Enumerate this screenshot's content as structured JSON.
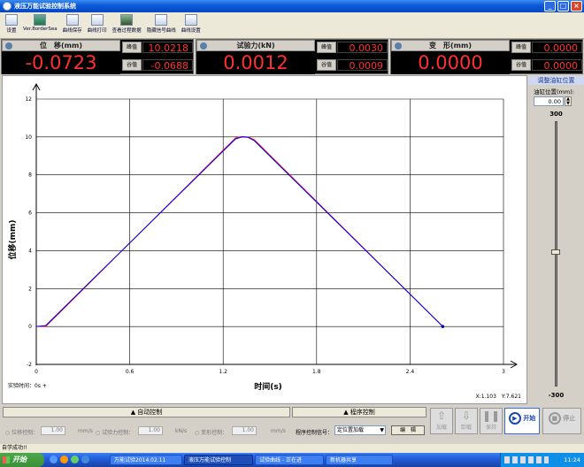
{
  "window": {
    "title": "液压万能试验控制系统"
  },
  "toolbar": [
    {
      "label": "设置",
      "icon": "settings-icon"
    },
    {
      "label": "Ver.8orderSea",
      "icon": "device-icon"
    },
    {
      "label": "曲线保存",
      "icon": "save-icon"
    },
    {
      "label": "曲线打印",
      "icon": "print-icon"
    },
    {
      "label": "查看过程数据",
      "icon": "data-icon"
    },
    {
      "label": "隐藏信号曲线",
      "icon": "signal-icon"
    },
    {
      "label": "曲线设置",
      "icon": "curve-icon"
    }
  ],
  "panels": {
    "displacement": {
      "label": "位　移(mm)",
      "value": "-0.0723",
      "peak_label": "峰值",
      "peak": "10.0218",
      "valley_label": "谷值",
      "valley": "-0.0688"
    },
    "force": {
      "label": "试验力(kN)",
      "value": "0.0012",
      "peak_label": "峰值",
      "peak": "0.0030",
      "valley_label": "谷值",
      "valley": "0.0009"
    },
    "deformation": {
      "label": "变　形(mm)",
      "value": "0.0000",
      "peak_label": "峰值",
      "peak": "0.0000",
      "valley_label": "谷值",
      "valley": "0.0000"
    }
  },
  "chart_data": {
    "type": "line",
    "xlabel": "时间(s)",
    "ylabel": "位移(mm)",
    "xlim": [
      0,
      3
    ],
    "ylim": [
      -2,
      12
    ],
    "xticks": [
      "0",
      "0.6",
      "1.2",
      "1.8",
      "2.4",
      "3"
    ],
    "yticks": [
      "-2",
      "0",
      "2",
      "4",
      "6",
      "8",
      "10",
      "12"
    ],
    "grid": true,
    "series": [
      {
        "color": "#ff0000",
        "x": [
          0,
          0.06,
          1.28,
          1.32,
          1.36,
          1.4,
          2.61
        ],
        "y": [
          0,
          0,
          9.95,
          10.02,
          10.0,
          9.85,
          0
        ]
      },
      {
        "color": "#0000ff",
        "x": [
          0,
          0.06,
          1.28,
          1.32,
          1.36,
          1.4,
          2.61
        ],
        "y": [
          0,
          0.05,
          9.9,
          10.0,
          9.98,
          9.8,
          0
        ]
      }
    ]
  },
  "chart_footer": {
    "test_time": "实验时间：0s +",
    "readout": "X:1.103　Y:7.621"
  },
  "side": {
    "title": "调整油缸位置",
    "cyl_label": "油缸位置(mm):",
    "cyl_value": "0.00",
    "top": "300",
    "bottom": "-300"
  },
  "bottom": {
    "auto_tab": "自动控制",
    "prog_tab": "程序控制",
    "disp_ctrl": "位移控制：",
    "disp_val": "1.00",
    "disp_unit": "mm/s",
    "force_ctrl": "试验力控制：",
    "force_val": "1.00",
    "force_unit": "kN/s",
    "def_ctrl": "变形控制：",
    "def_val": "1.00",
    "def_unit": "mm/s",
    "prog_label": "程序控制信号：",
    "prog_select": "定位置加载",
    "edit": "编　辑",
    "load": "加载",
    "unload": "卸载",
    "hold": "保持",
    "start": "开始",
    "stop": "停止"
  },
  "status": {
    "text": "自学成功!!"
  },
  "taskbar": {
    "start": "开始",
    "items": [
      "万能试验2014.02.11",
      "液压万能试验控制",
      "试验曲线 - 正在进",
      "新机器共享"
    ],
    "clock": "11:24"
  }
}
